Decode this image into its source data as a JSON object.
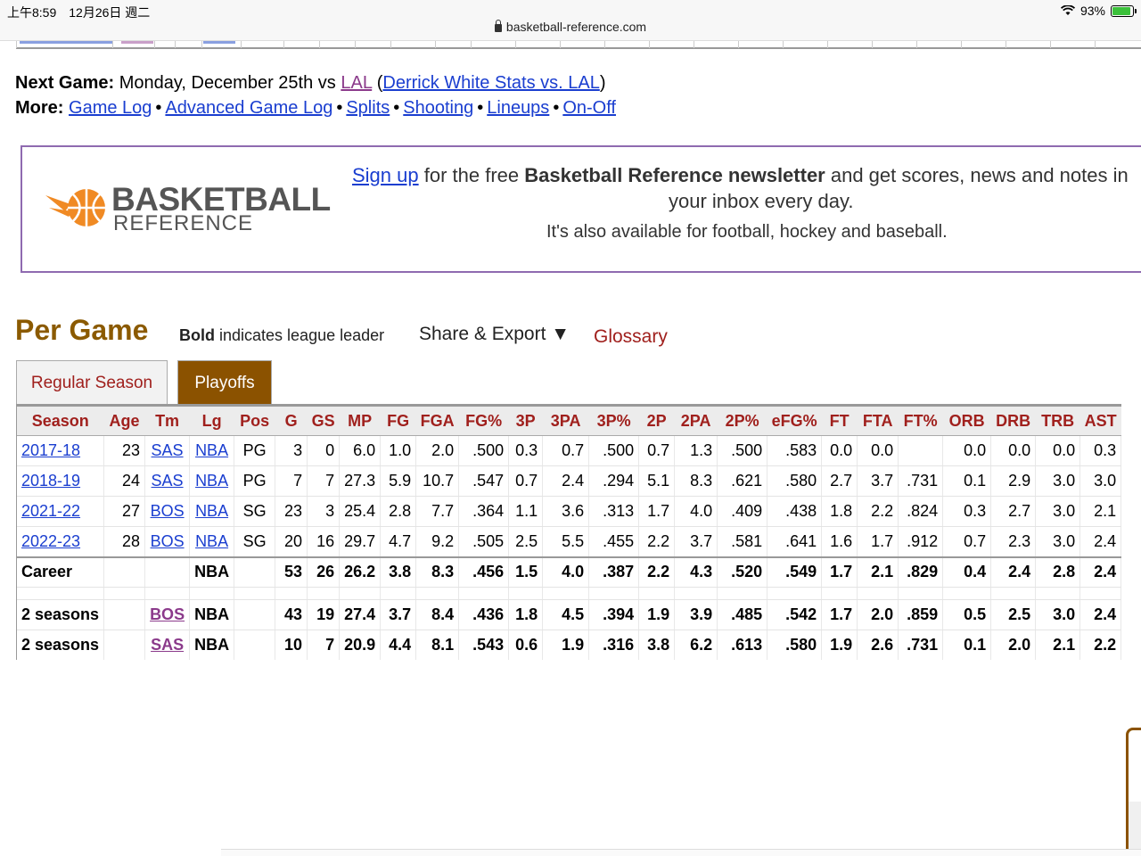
{
  "status_bar": {
    "clock": "上午8:59　12月26日 週二",
    "battery_percent": "93%",
    "url": "basketball-reference.com"
  },
  "next_game": {
    "label": "Next Game:",
    "text": " Monday, December 25th vs ",
    "opponent": "LAL",
    "paren_open": " (",
    "link": "Derrick White Stats vs. LAL",
    "paren_close": ")"
  },
  "more": {
    "label": "More:",
    "links": [
      "Game Log",
      "Advanced Game Log",
      "Splits",
      "Shooting",
      "Lineups",
      "On-Off"
    ]
  },
  "newsletter": {
    "logo_word1": "BASKETBALL",
    "logo_word2": "REFERENCE",
    "signup_link": "Sign up",
    "text_a": " for the free ",
    "bold_name": "Basketball Reference newsletter",
    "text_b": " and get scores, news and notes in",
    "line2": "your inbox every day.",
    "line3": "It's also available for football, hockey and baseball."
  },
  "section": {
    "title": "Per Game",
    "bold_word": "Bold",
    "bold_note": " indicates league leader",
    "share_export": "Share & Export ▼",
    "glossary": "Glossary"
  },
  "tabs": {
    "regular": "Regular Season",
    "playoffs": "Playoffs"
  },
  "table": {
    "columns": [
      "Season",
      "Age",
      "Tm",
      "Lg",
      "Pos",
      "G",
      "GS",
      "MP",
      "FG",
      "FGA",
      "FG%",
      "3P",
      "3PA",
      "3P%",
      "2P",
      "2PA",
      "2P%",
      "eFG%",
      "FT",
      "FTA",
      "FT%",
      "ORB",
      "DRB",
      "TRB",
      "AST"
    ],
    "rows": [
      [
        "2017-18",
        "23",
        "SAS",
        "NBA",
        "PG",
        "3",
        "0",
        "6.0",
        "1.0",
        "2.0",
        ".500",
        "0.3",
        "0.7",
        ".500",
        "0.7",
        "1.3",
        ".500",
        ".583",
        "0.0",
        "0.0",
        "",
        "0.0",
        "0.0",
        "0.0",
        "0.3"
      ],
      [
        "2018-19",
        "24",
        "SAS",
        "NBA",
        "PG",
        "7",
        "7",
        "27.3",
        "5.9",
        "10.7",
        ".547",
        "0.7",
        "2.4",
        ".294",
        "5.1",
        "8.3",
        ".621",
        ".580",
        "2.7",
        "3.7",
        ".731",
        "0.1",
        "2.9",
        "3.0",
        "3.0"
      ],
      [
        "2021-22",
        "27",
        "BOS",
        "NBA",
        "SG",
        "23",
        "3",
        "25.4",
        "2.8",
        "7.7",
        ".364",
        "1.1",
        "3.6",
        ".313",
        "1.7",
        "4.0",
        ".409",
        ".438",
        "1.8",
        "2.2",
        ".824",
        "0.3",
        "2.7",
        "3.0",
        "2.1"
      ],
      [
        "2022-23",
        "28",
        "BOS",
        "NBA",
        "SG",
        "20",
        "16",
        "29.7",
        "4.7",
        "9.2",
        ".505",
        "2.5",
        "5.5",
        ".455",
        "2.2",
        "3.7",
        ".581",
        ".641",
        "1.6",
        "1.7",
        ".912",
        "0.7",
        "2.3",
        "3.0",
        "2.4"
      ]
    ],
    "career": [
      "Career",
      "",
      "",
      "NBA",
      "",
      "53",
      "26",
      "26.2",
      "3.8",
      "8.3",
      ".456",
      "1.5",
      "4.0",
      ".387",
      "2.2",
      "4.3",
      ".520",
      ".549",
      "1.7",
      "2.1",
      ".829",
      "0.4",
      "2.4",
      "2.8",
      "2.4"
    ],
    "team_totals": [
      [
        "2 seasons",
        "",
        "BOS",
        "NBA",
        "",
        "43",
        "19",
        "27.4",
        "3.7",
        "8.4",
        ".436",
        "1.8",
        "4.5",
        ".394",
        "1.9",
        "3.9",
        ".485",
        ".542",
        "1.7",
        "2.0",
        ".859",
        "0.5",
        "2.5",
        "3.0",
        "2.4"
      ],
      [
        "2 seasons",
        "",
        "SAS",
        "NBA",
        "",
        "10",
        "7",
        "20.9",
        "4.4",
        "8.1",
        ".543",
        "0.6",
        "1.9",
        ".316",
        "3.8",
        "6.2",
        ".613",
        ".580",
        "1.9",
        "2.6",
        ".731",
        "0.1",
        "2.0",
        "2.1",
        "2.2"
      ]
    ]
  }
}
